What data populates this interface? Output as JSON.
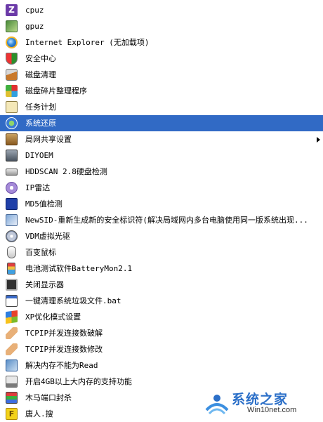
{
  "menu": {
    "items": [
      {
        "label": "cpuz",
        "icon": "cpuz-icon",
        "cls": "i-cpuz",
        "glyph": "Z"
      },
      {
        "label": "gpuz",
        "icon": "gpuz-icon",
        "cls": "i-gpuz"
      },
      {
        "label": "Internet Explorer (无加载项)",
        "icon": "internet-explorer-icon",
        "cls": "i-ie"
      },
      {
        "label": "安全中心",
        "icon": "security-center-shield-icon",
        "cls": "i-shield"
      },
      {
        "label": "磁盘清理",
        "icon": "disk-cleanup-icon",
        "cls": "i-broom"
      },
      {
        "label": "磁盘碎片整理程序",
        "icon": "disk-defragmenter-icon",
        "cls": "i-defrag"
      },
      {
        "label": "任务计划",
        "icon": "scheduled-tasks-icon",
        "cls": "i-task"
      },
      {
        "label": "系统还原",
        "icon": "system-restore-icon",
        "cls": "i-restore",
        "selected": true
      },
      {
        "label": "局网共享设置",
        "icon": "lan-share-settings-icon",
        "cls": "i-network",
        "submenu": true
      },
      {
        "label": "DIYOEM",
        "icon": "diyoem-icon",
        "cls": "i-diyoem"
      },
      {
        "label": "HDDSCAN 2.8硬盘检测",
        "icon": "hard-disk-icon",
        "cls": "i-hdd"
      },
      {
        "label": "IP雷达",
        "icon": "ip-radar-icon",
        "cls": "i-ip"
      },
      {
        "label": "MD5值检测",
        "icon": "md5-check-icon",
        "cls": "i-md5"
      },
      {
        "label": "NewSID-重新生成新的安全标识符(解决局域网内多台电脑使用同一版系统出现...",
        "icon": "newsid-icon",
        "cls": "i-newsid"
      },
      {
        "label": "VDM虚拟光驱",
        "icon": "virtual-cd-drive-icon",
        "cls": "i-vdm"
      },
      {
        "label": "百变鼠标",
        "icon": "mouse-icon",
        "cls": "i-mouse"
      },
      {
        "label": "电池测试软件BatteryMon2.1",
        "icon": "battery-icon",
        "cls": "i-battery"
      },
      {
        "label": "关闭显示器",
        "icon": "monitor-icon",
        "cls": "i-monitor"
      },
      {
        "label": "一键清理系统垃圾文件.bat",
        "icon": "batch-file-icon",
        "cls": "i-bat"
      },
      {
        "label": "XP优化模式设置",
        "icon": "windows-xp-icon",
        "cls": "i-xp"
      },
      {
        "label": "TCPIP并发连接数破解",
        "icon": "bandage-icon",
        "cls": "i-bandage"
      },
      {
        "label": "TCPIP并发连接数修改",
        "icon": "bandage-icon",
        "cls": "i-bandage"
      },
      {
        "label": "解决内存不能为Read",
        "icon": "memory-fix-icon",
        "cls": "i-memory"
      },
      {
        "label": "开启4GB以上大内存的支持功能",
        "icon": "large-memory-icon",
        "cls": "i-4gb"
      },
      {
        "label": "木马端口封杀",
        "icon": "trojan-port-icon",
        "cls": "i-trojan"
      },
      {
        "label": "唐人.搜",
        "icon": "tangren-search-icon",
        "cls": "i-tang",
        "glyph": "F"
      }
    ]
  },
  "watermark": {
    "title": "系统之家",
    "url": "Win10net.com"
  }
}
